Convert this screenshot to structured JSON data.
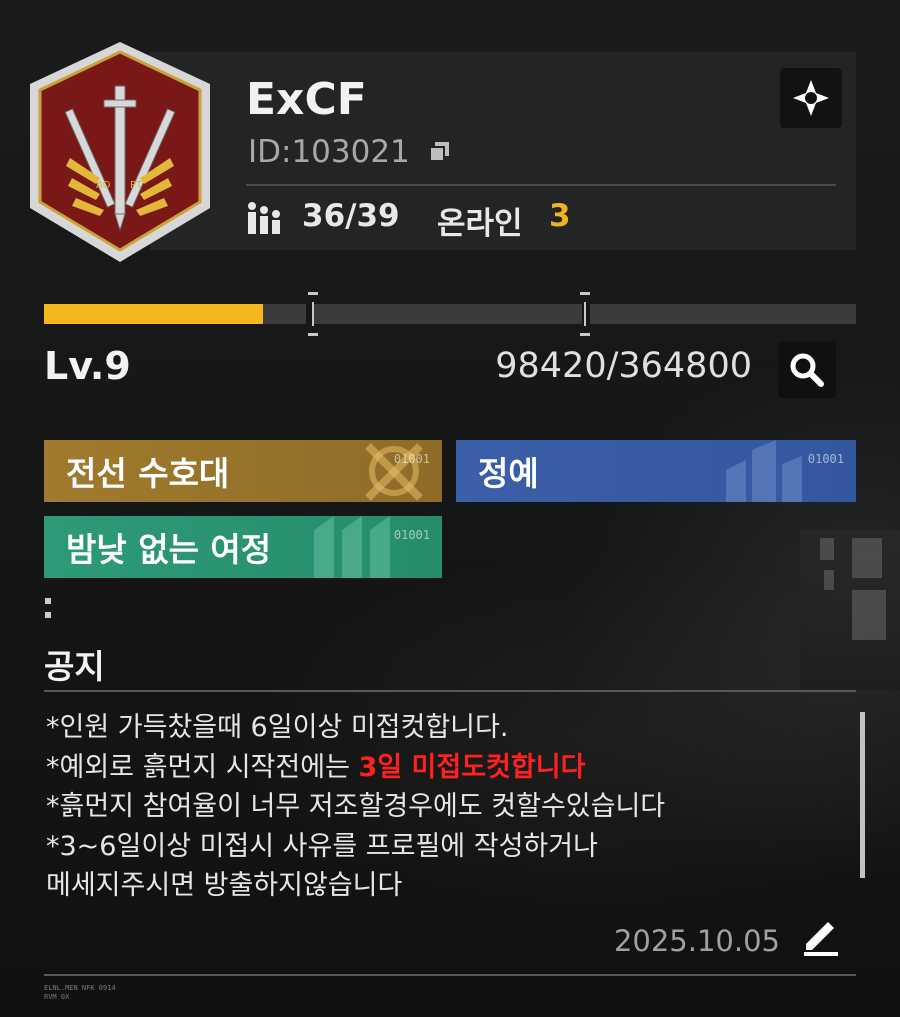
{
  "guild": {
    "name": "ExCF",
    "id_label": "ID:103021",
    "members": "36/39",
    "online_label": "온라인",
    "online_count": "3",
    "emblem_text_left": "AO",
    "emblem_text_right": "PT"
  },
  "level": {
    "label": "Lv.9",
    "xp": "98420/364800",
    "progress_fraction": 0.27
  },
  "tags": [
    {
      "label": "전선 수호대",
      "code": "01001",
      "color": "#a07b2e"
    },
    {
      "label": "정예",
      "code": "01001",
      "color": "#3b5fa8"
    },
    {
      "label": "밤낮 없는 여정",
      "code": "01001",
      "color": "#2d9a78"
    }
  ],
  "notice": {
    "title": "공지",
    "lines": [
      "*인원 가득찼을때 6일이상 미접컷합니다.",
      "*예외로 흙먼지 시작전에는 ",
      "3일 미접도컷합니다",
      "*흙먼지 참여율이 너무 저조할경우에도 컷할수있습니다",
      "*3~6일이상 미접시 사유를 프로필에 작성하거나",
      "메세지주시면 방출하지않습니다"
    ],
    "highlight_color": "#ff2020",
    "date": "2025.10.05"
  },
  "footer": {
    "line1": "ELNL.MEN NFK 0914",
    "line2": "RVM 0X"
  },
  "icons": {
    "settings": "crosshair-settings-icon",
    "copy": "copy-icon",
    "members": "members-icon",
    "search": "search-icon",
    "edit": "pencil-icon"
  },
  "colors": {
    "accent_gold": "#f4b81d",
    "online_count": "#f0b422"
  }
}
